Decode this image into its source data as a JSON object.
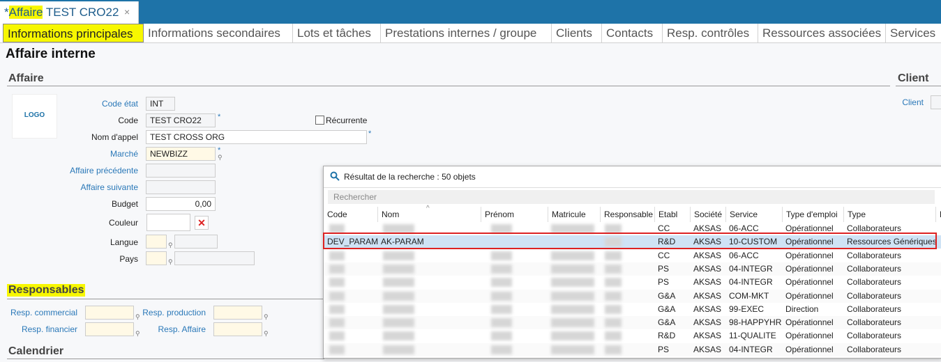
{
  "doc_tab": {
    "prefix": "*",
    "highlight": "Affaire",
    "rest": " TEST CRO22",
    "close": "×"
  },
  "tabs": [
    "Informations principales",
    "Informations secondaires",
    "Lots et tâches",
    "Prestations internes / groupe",
    "Clients",
    "Contacts",
    "Resp. contrôles",
    "Ressources associées",
    "Services"
  ],
  "page_title": "Affaire interne",
  "affaire": {
    "section": "Affaire",
    "logo": "LOGO",
    "code_etat_label": "Code état",
    "code_etat": "INT",
    "code_label": "Code",
    "code": "TEST CRO22",
    "recurrente_label": "Récurrente",
    "nom_label": "Nom d'appel",
    "nom": "TEST CROSS ORG",
    "marche_label": "Marché",
    "marche": "NEWBIZZ",
    "precedente_label": "Affaire précédente",
    "suivante_label": "Affaire suivante",
    "budget_label": "Budget",
    "budget": "0,00",
    "couleur_label": "Couleur",
    "langue_label": "Langue",
    "pays_label": "Pays"
  },
  "client": {
    "section": "Client",
    "client_label": "Client"
  },
  "responsables": {
    "section": "Responsables",
    "commercial": "Resp. commercial",
    "production": "Resp. production",
    "financier": "Resp. financier",
    "affaire": "Resp. Affaire"
  },
  "calendrier": {
    "section": "Calendrier"
  },
  "popup": {
    "title": "Résultat de la recherche : 50 objets",
    "search_placeholder": "Rechercher",
    "columns": [
      "Code",
      "Nom",
      "Prénom",
      "Matricule",
      "Responsable",
      "Etabl",
      "Société",
      "Service",
      "Type d'emploi",
      "Type",
      "D"
    ],
    "rows": [
      {
        "code": "",
        "nom": "",
        "etabl": "CC",
        "societe": "AKSAS",
        "service": "06-ACC",
        "emploi": "Opérationnel",
        "type": "Collaborateurs"
      },
      {
        "code": "DEV_PARAM",
        "nom": "AK-PARAM",
        "etabl": "R&D",
        "societe": "AKSAS",
        "service": "10-CUSTOM",
        "emploi": "Opérationnel",
        "type": "Ressources Génériques"
      },
      {
        "code": "",
        "nom": "",
        "etabl": "CC",
        "societe": "AKSAS",
        "service": "06-ACC",
        "emploi": "Opérationnel",
        "type": "Collaborateurs"
      },
      {
        "code": "",
        "nom": "",
        "etabl": "PS",
        "societe": "AKSAS",
        "service": "04-INTEGR",
        "emploi": "Opérationnel",
        "type": "Collaborateurs"
      },
      {
        "code": "",
        "nom": "",
        "etabl": "PS",
        "societe": "AKSAS",
        "service": "04-INTEGR",
        "emploi": "Opérationnel",
        "type": "Collaborateurs"
      },
      {
        "code": "",
        "nom": "",
        "etabl": "G&A",
        "societe": "AKSAS",
        "service": "COM-MKT",
        "emploi": "Opérationnel",
        "type": "Collaborateurs"
      },
      {
        "code": "",
        "nom": "",
        "etabl": "G&A",
        "societe": "AKSAS",
        "service": "99-EXEC",
        "emploi": "Direction",
        "type": "Collaborateurs"
      },
      {
        "code": "",
        "nom": "",
        "etabl": "G&A",
        "societe": "AKSAS",
        "service": "98-HAPPYHR",
        "emploi": "Opérationnel",
        "type": "Collaborateurs"
      },
      {
        "code": "",
        "nom": "",
        "etabl": "R&D",
        "societe": "AKSAS",
        "service": "11-QUALITE",
        "emploi": "Opérationnel",
        "type": "Collaborateurs"
      },
      {
        "code": "",
        "nom": "",
        "etabl": "PS",
        "societe": "AKSAS",
        "service": "04-INTEGR",
        "emploi": "Opérationnel",
        "type": "Collaborateurs"
      }
    ]
  },
  "colors": {
    "accent": "#1e73a8",
    "highlight": "#f7f700",
    "selection": "#cfe3f5",
    "selection_border": "#d22222"
  }
}
